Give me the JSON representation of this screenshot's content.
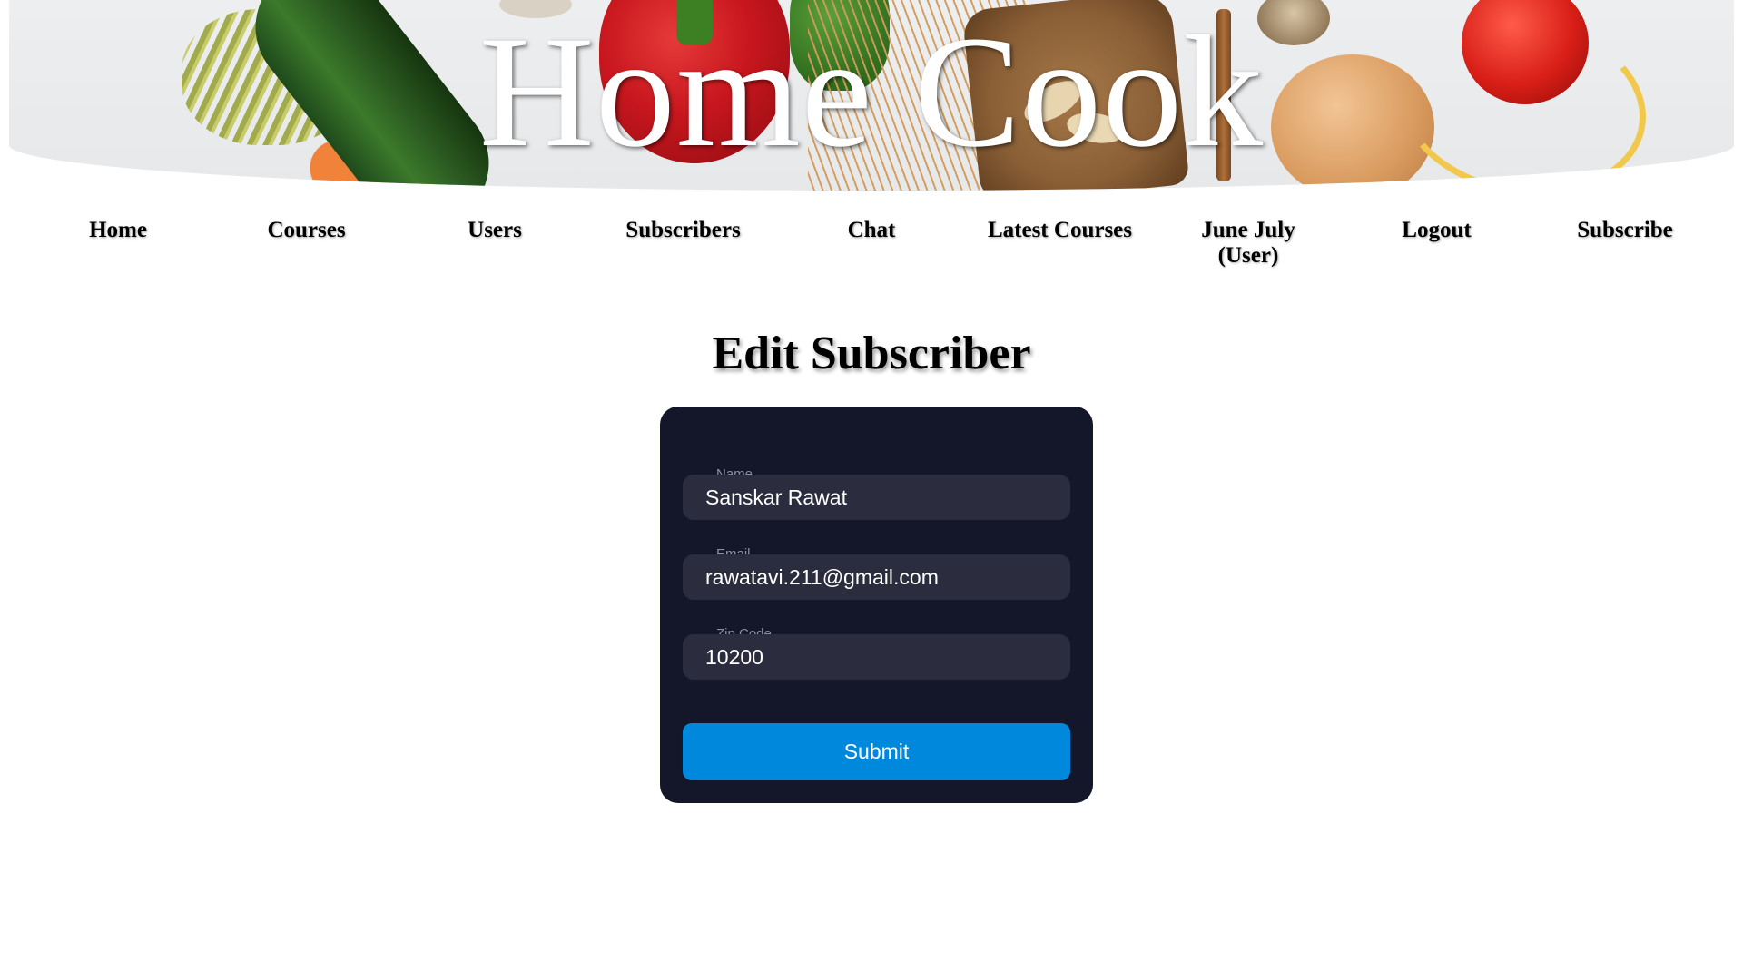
{
  "banner": {
    "title": "Home Cook"
  },
  "nav": {
    "items": [
      {
        "label": "Home"
      },
      {
        "label": "Courses"
      },
      {
        "label": "Users"
      },
      {
        "label": "Subscribers"
      },
      {
        "label": "Chat"
      },
      {
        "label": "Latest Courses"
      },
      {
        "label": "June July (User)"
      },
      {
        "label": "Logout"
      },
      {
        "label": "Subscribe"
      }
    ]
  },
  "page": {
    "title": "Edit Subscriber"
  },
  "form": {
    "name": {
      "label": "Name",
      "value": "Sanskar Rawat"
    },
    "email": {
      "label": "Email",
      "value": "rawatavi.211@gmail.com"
    },
    "zip": {
      "label": "Zip Code",
      "value": "10200"
    },
    "submit_label": "Submit"
  },
  "colors": {
    "card_background": "#14172a",
    "input_background": "#2b2d3e",
    "submit_button": "#0088dd"
  }
}
